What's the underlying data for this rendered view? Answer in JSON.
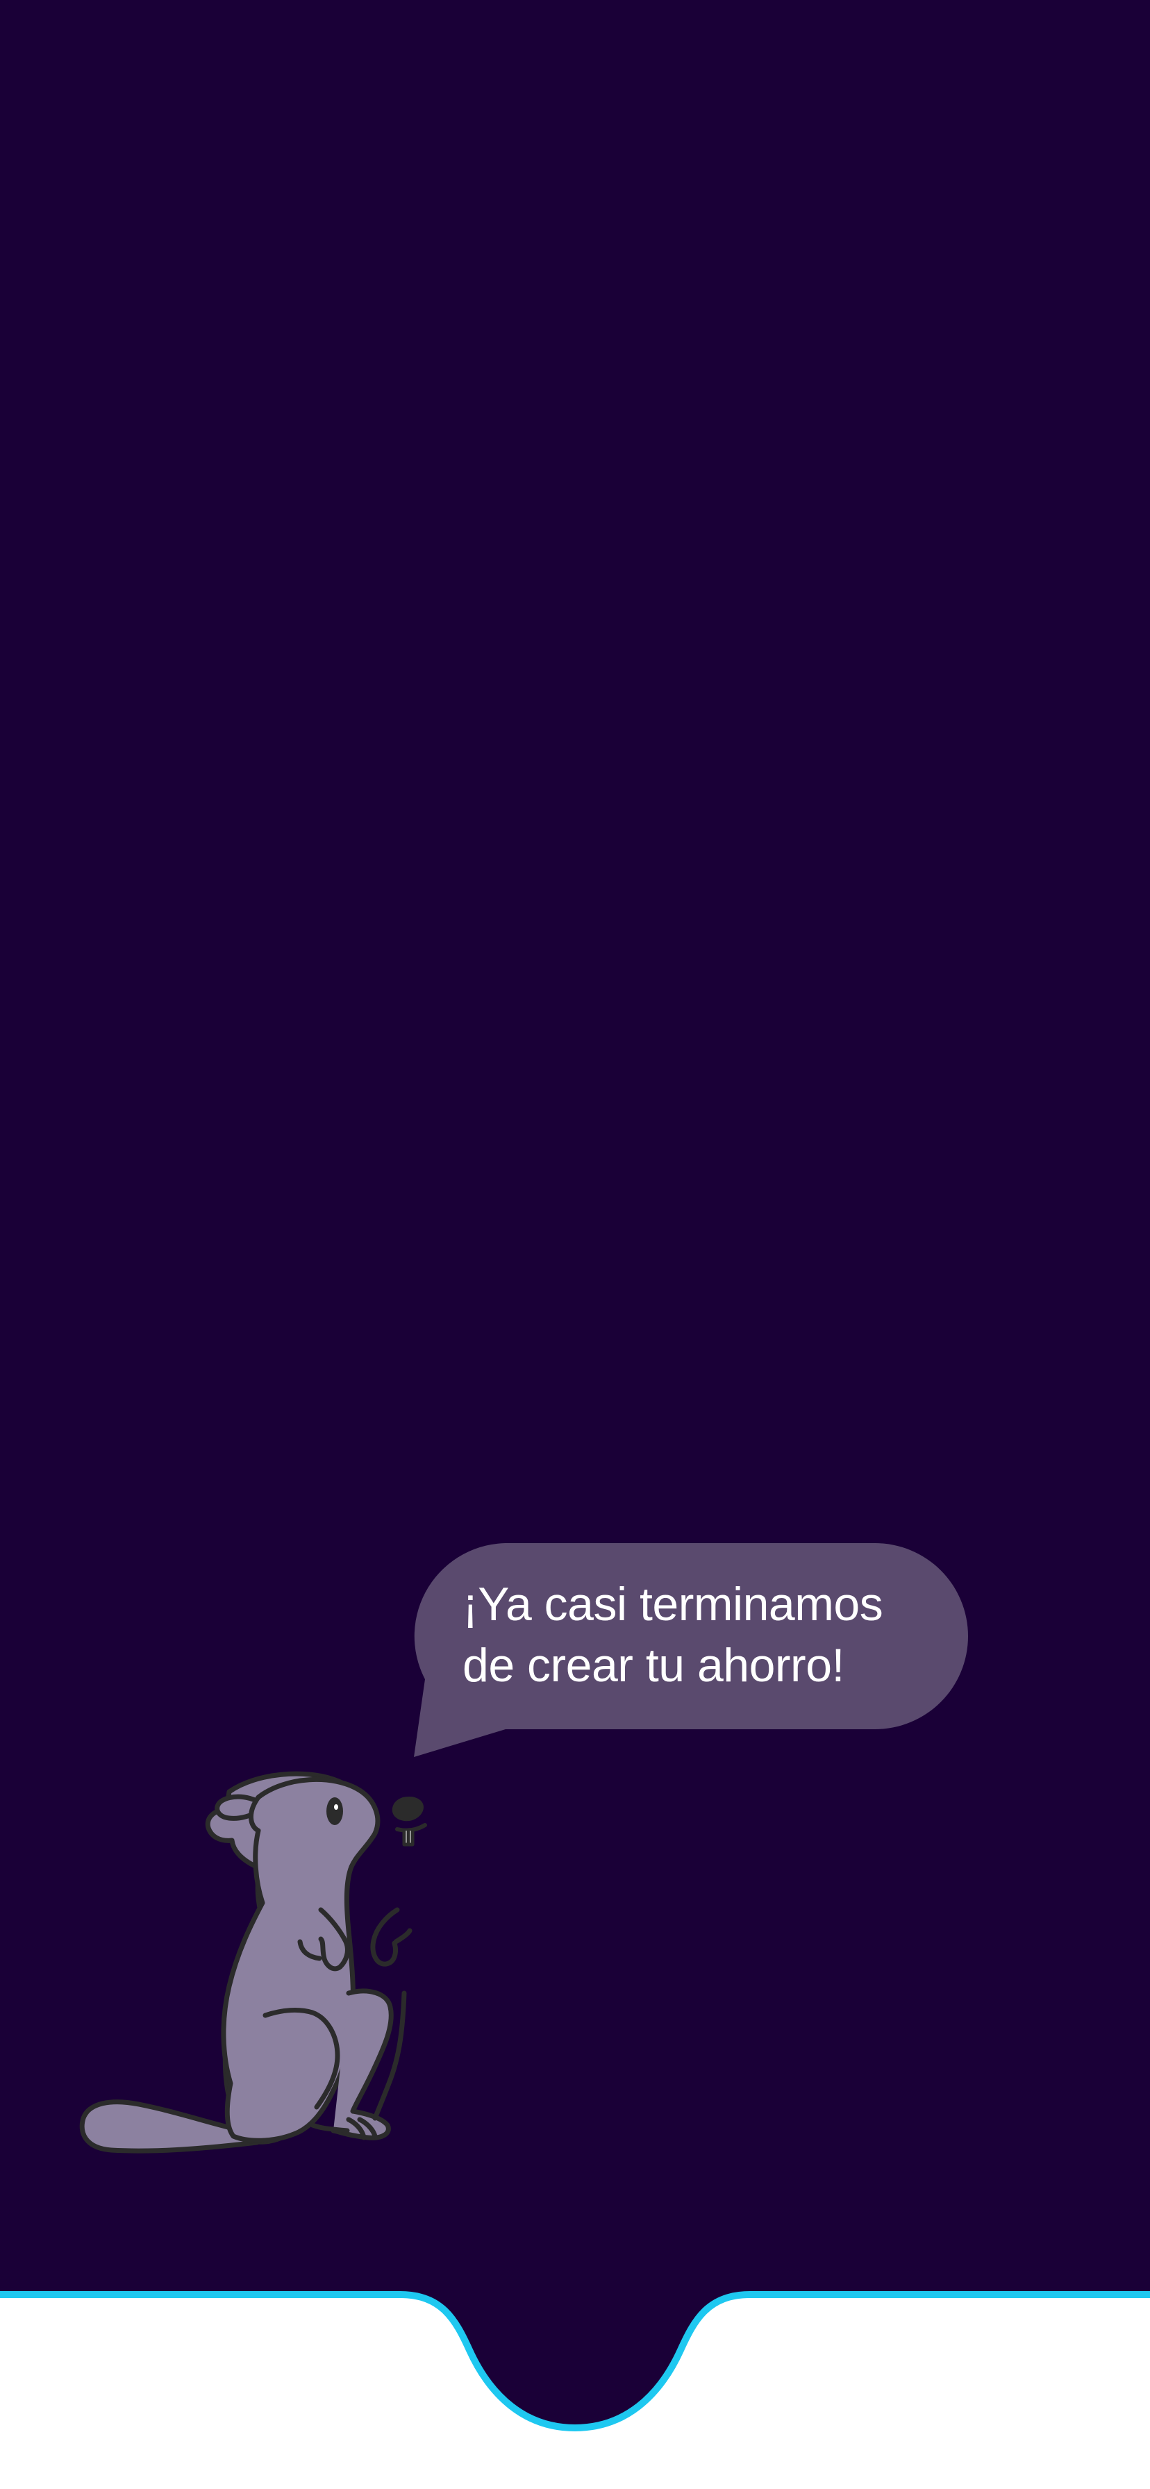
{
  "colors": {
    "background": "#1a0037",
    "bubble": "#5a4a6e",
    "bubble_text": "#ffffff",
    "accent_border": "#1ec8f0",
    "bottom_area": "#ffffff",
    "mascot_body": "#8c81a0",
    "mascot_outline": "#2b2b2b"
  },
  "speech_bubble": {
    "line1": "¡Ya casi terminamos",
    "line2": "de crear tu ahorro!"
  },
  "mascot": {
    "icon": "beaver-icon"
  }
}
